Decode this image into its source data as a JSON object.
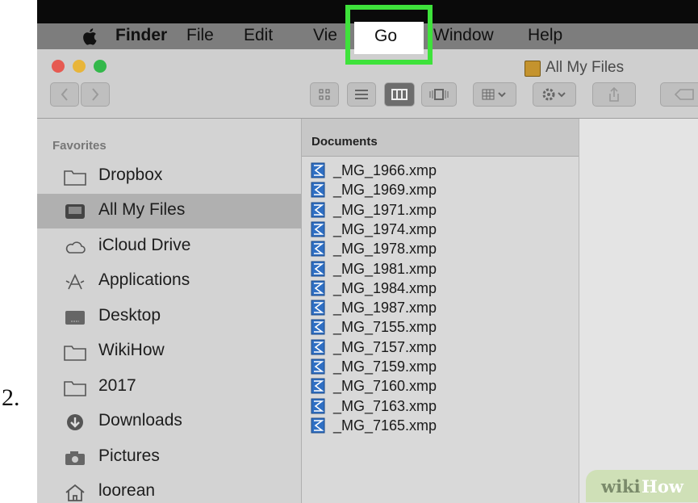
{
  "step_number": "2.",
  "menubar": {
    "apple": "",
    "items": [
      "Finder",
      "File",
      "Edit",
      "Vie",
      "Go",
      "Window",
      "Help"
    ]
  },
  "window": {
    "title": "All My Files"
  },
  "toolbar": {
    "nav": [
      "back-button",
      "forward-button"
    ],
    "view_modes": [
      "icon-view",
      "list-view",
      "column-view",
      "cover-flow-view"
    ],
    "active_view": "column-view"
  },
  "sidebar": {
    "heading": "Favorites",
    "items": [
      {
        "label": "Dropbox",
        "icon": "folder-icon"
      },
      {
        "label": "All My Files",
        "icon": "all-files-icon"
      },
      {
        "label": "iCloud Drive",
        "icon": "cloud-icon"
      },
      {
        "label": "Applications",
        "icon": "applications-icon"
      },
      {
        "label": "Desktop",
        "icon": "desktop-icon"
      },
      {
        "label": "WikiHow",
        "icon": "folder-icon"
      },
      {
        "label": "2017",
        "icon": "folder-icon"
      },
      {
        "label": "Downloads",
        "icon": "download-icon"
      },
      {
        "label": "Pictures",
        "icon": "camera-icon"
      },
      {
        "label": "loorean",
        "icon": "home-icon"
      }
    ],
    "selected_index": 1
  },
  "column": {
    "header": "Documents",
    "files": [
      "_MG_1966.xmp",
      "_MG_1969.xmp",
      "_MG_1971.xmp",
      "_MG_1974.xmp",
      "_MG_1978.xmp",
      "_MG_1981.xmp",
      "_MG_1984.xmp",
      "_MG_1987.xmp",
      "_MG_7155.xmp",
      "_MG_7157.xmp",
      "_MG_7159.xmp",
      "_MG_7160.xmp",
      "_MG_7163.xmp",
      "_MG_7165.xmp"
    ]
  },
  "watermark": {
    "part1": "wiki",
    "part2": "How"
  },
  "colors": {
    "highlight": "#3ee23b",
    "menubar": "#7d7d7d"
  }
}
